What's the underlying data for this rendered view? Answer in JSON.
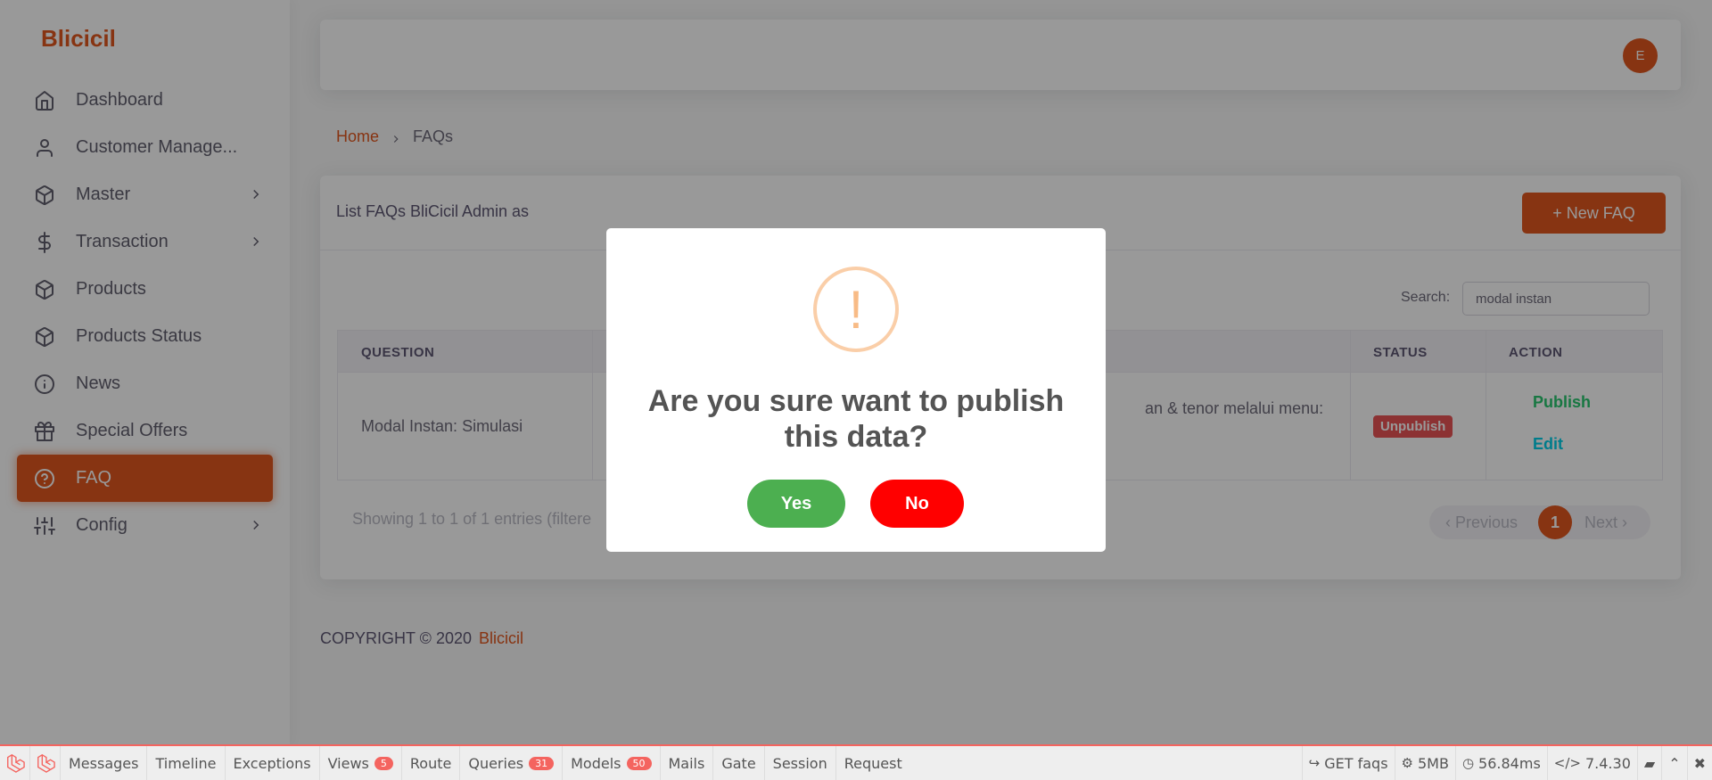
{
  "brand": "Blicicil",
  "sidebar": {
    "items": [
      {
        "label": "Dashboard",
        "icon": "home-icon"
      },
      {
        "label": "Customer Manage...",
        "icon": "user-icon"
      },
      {
        "label": "Master",
        "icon": "box-icon",
        "has_submenu": true
      },
      {
        "label": "Transaction",
        "icon": "dollar-icon",
        "has_submenu": true
      },
      {
        "label": "Products",
        "icon": "box-icon"
      },
      {
        "label": "Products Status",
        "icon": "box-icon"
      },
      {
        "label": "News",
        "icon": "info-icon"
      },
      {
        "label": "Special Offers",
        "icon": "gift-icon"
      },
      {
        "label": "FAQ",
        "icon": "help-circle-icon",
        "active": true
      },
      {
        "label": "Config",
        "icon": "sliders-icon",
        "has_submenu": true
      }
    ]
  },
  "topbar": {
    "avatar_initial": "E"
  },
  "breadcrumb": {
    "home": "Home",
    "current": "FAQs"
  },
  "card": {
    "title": "List FAQs BliCicil Admin as",
    "new_button": "+ New FAQ",
    "search_label": "Search:",
    "search_value": "modal instan",
    "columns": [
      "QUESTION",
      "STATUS",
      "ACTION"
    ],
    "rows": [
      {
        "question": "Modal Instan: Simulasi",
        "answer_fragment": "an & tenor melalui menu:",
        "status": "Unpublish",
        "actions": {
          "publish": "Publish",
          "edit": "Edit"
        }
      }
    ],
    "showing": "Showing 1 to 1 of 1 entries (filtere",
    "pagination": {
      "previous": "Previous",
      "current": "1",
      "next": "Next"
    }
  },
  "footer": {
    "copyright": "COPYRIGHT © 2020",
    "brand": "Blicicil"
  },
  "modal": {
    "icon": "!",
    "title": "Are you sure want to publish this data?",
    "yes": "Yes",
    "no": "No"
  },
  "debugbar": {
    "tabs": [
      {
        "label": "Messages"
      },
      {
        "label": "Timeline"
      },
      {
        "label": "Exceptions"
      },
      {
        "label": "Views",
        "badge": "5"
      },
      {
        "label": "Route"
      },
      {
        "label": "Queries",
        "badge": "31"
      },
      {
        "label": "Models",
        "badge": "50"
      },
      {
        "label": "Mails"
      },
      {
        "label": "Gate"
      },
      {
        "label": "Session"
      },
      {
        "label": "Request"
      }
    ],
    "request": "GET faqs",
    "memory": "5MB",
    "time": "56.84ms",
    "php_version": "7.4.30"
  },
  "colors": {
    "accent": "#e2571e",
    "success": "#4caf50",
    "danger": "#ff0000",
    "debug": "#f4645f"
  }
}
